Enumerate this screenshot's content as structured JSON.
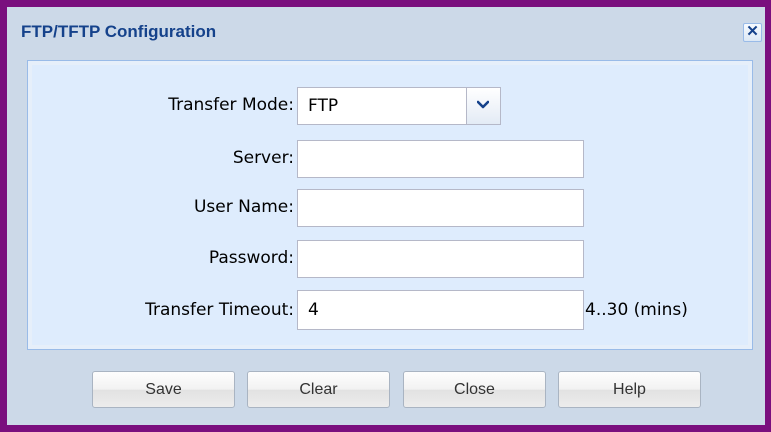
{
  "dialog": {
    "title": "FTP/TFTP Configuration",
    "close_icon": "close-icon"
  },
  "form": {
    "transfer_mode": {
      "label": "Transfer Mode:",
      "value": "FTP",
      "icon": "chevron-down-icon"
    },
    "server": {
      "label": "Server:",
      "value": ""
    },
    "user_name": {
      "label": "User Name:",
      "value": ""
    },
    "password": {
      "label": "Password:",
      "value": ""
    },
    "transfer_timeout": {
      "label": "Transfer Timeout:",
      "value": "4",
      "hint": "4..30 (mins)"
    }
  },
  "buttons": {
    "save": "Save",
    "clear": "Clear",
    "close": "Close",
    "help": "Help"
  },
  "colors": {
    "frame": "#7a0f7e",
    "dialog_bg": "#ccd9e8",
    "panel_bg": "#deecfd",
    "title_text": "#15428b"
  }
}
